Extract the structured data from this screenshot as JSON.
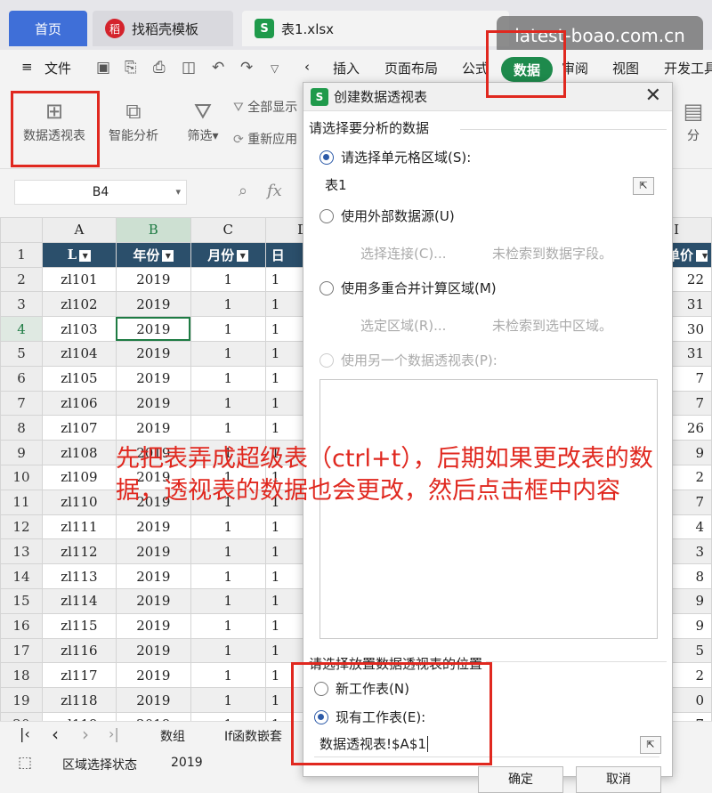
{
  "tabs": {
    "home": "首页",
    "template": "找稻壳模板",
    "template_logo": "稻",
    "file": "表1.xlsx",
    "file_logo": "S"
  },
  "watermark": "latest-boao.com.cn",
  "menu": {
    "hamburger": "≡",
    "file": "文件",
    "chevron_left": "‹",
    "insert": "插入",
    "page_layout": "页面布局",
    "formula": "公式",
    "data": "数据",
    "review": "审阅",
    "view": "视图",
    "developer": "开发工具"
  },
  "ribbon": {
    "pivot_table": "数据透视表",
    "smart_analysis": "智能分析",
    "filter": "筛选",
    "filter_arrow": "▾",
    "show_all": "全部显示",
    "reapply": "重新应用",
    "right_partial": "分"
  },
  "formula_bar": {
    "cell_ref": "B4",
    "name_arrow": "▾",
    "fx": "fx"
  },
  "grid": {
    "columns": [
      "A",
      "B",
      "C",
      "D",
      "I"
    ],
    "selected_column": "B",
    "header_row": [
      "L",
      "年份",
      "月份",
      "日",
      "单价"
    ],
    "rows": [
      {
        "n": "2",
        "a": "zl101",
        "b": "2019",
        "c": "1",
        "d": "1",
        "i": "22"
      },
      {
        "n": "3",
        "a": "zl102",
        "b": "2019",
        "c": "1",
        "d": "1",
        "i": "31"
      },
      {
        "n": "4",
        "a": "zl103",
        "b": "2019",
        "c": "1",
        "d": "1",
        "i": "30"
      },
      {
        "n": "5",
        "a": "zl104",
        "b": "2019",
        "c": "1",
        "d": "1",
        "i": "31"
      },
      {
        "n": "6",
        "a": "zl105",
        "b": "2019",
        "c": "1",
        "d": "1",
        "i": "7"
      },
      {
        "n": "7",
        "a": "zl106",
        "b": "2019",
        "c": "1",
        "d": "1",
        "i": "7"
      },
      {
        "n": "8",
        "a": "zl107",
        "b": "2019",
        "c": "1",
        "d": "1",
        "i": "26"
      },
      {
        "n": "9",
        "a": "zl108",
        "b": "2019",
        "c": "1",
        "d": "1",
        "i": "9"
      },
      {
        "n": "10",
        "a": "zl109",
        "b": "2019",
        "c": "1",
        "d": "1",
        "i": "2"
      },
      {
        "n": "11",
        "a": "zl110",
        "b": "2019",
        "c": "1",
        "d": "1",
        "i": "7"
      },
      {
        "n": "12",
        "a": "zl111",
        "b": "2019",
        "c": "1",
        "d": "1",
        "i": "4"
      },
      {
        "n": "13",
        "a": "zl112",
        "b": "2019",
        "c": "1",
        "d": "1",
        "i": "3"
      },
      {
        "n": "14",
        "a": "zl113",
        "b": "2019",
        "c": "1",
        "d": "1",
        "i": "8"
      },
      {
        "n": "15",
        "a": "zl114",
        "b": "2019",
        "c": "1",
        "d": "1",
        "i": "9"
      },
      {
        "n": "16",
        "a": "zl115",
        "b": "2019",
        "c": "1",
        "d": "1",
        "i": "9"
      },
      {
        "n": "17",
        "a": "zl116",
        "b": "2019",
        "c": "1",
        "d": "1",
        "i": "5"
      },
      {
        "n": "18",
        "a": "zl117",
        "b": "2019",
        "c": "1",
        "d": "1",
        "i": "2"
      },
      {
        "n": "19",
        "a": "zl118",
        "b": "2019",
        "c": "1",
        "d": "1",
        "i": "0"
      },
      {
        "n": "20",
        "a": "zl119",
        "b": "2019",
        "c": "1",
        "d": "1",
        "i": "7"
      }
    ]
  },
  "sheet_tabs": {
    "first": "|‹",
    "prev": "‹",
    "next": "›",
    "last": "›|",
    "tab1": "数组",
    "tab2": "If函数嵌套"
  },
  "status": {
    "mode": "区域选择状态",
    "value": "2019"
  },
  "dialog": {
    "logo": "S",
    "title": "创建数据透视表",
    "close": "✕",
    "section_source": "请选择要分析的数据",
    "opt_range": "请选择单元格区域(S):",
    "range_value": "表1",
    "opt_external": "使用外部数据源(U)",
    "choose_connection": "选择连接(C)...",
    "no_fields": "未检索到数据字段。",
    "opt_multi": "使用多重合并计算区域(M)",
    "choose_region": "选定区域(R)...",
    "no_region": "未检索到选中区域。",
    "opt_other_pivot": "使用另一个数据透视表(P):",
    "section_place": "请选择放置数据透视表的位置",
    "opt_new_sheet": "新工作表(N)",
    "opt_existing_sheet": "现有工作表(E):",
    "place_value": "数据透视表!$A$1",
    "ok": "确定",
    "cancel": "取消"
  },
  "annotation": "先把表弄成超级表（ctrl+t），后期如果更改表的数据，透视表的数据也会更改，然后点击框中内容",
  "colors": {
    "accent_green": "#1e8a4c",
    "header_blue": "#2b4f6b",
    "highlight_red": "#e0281f",
    "home_tab_blue": "#3f6fd8"
  }
}
